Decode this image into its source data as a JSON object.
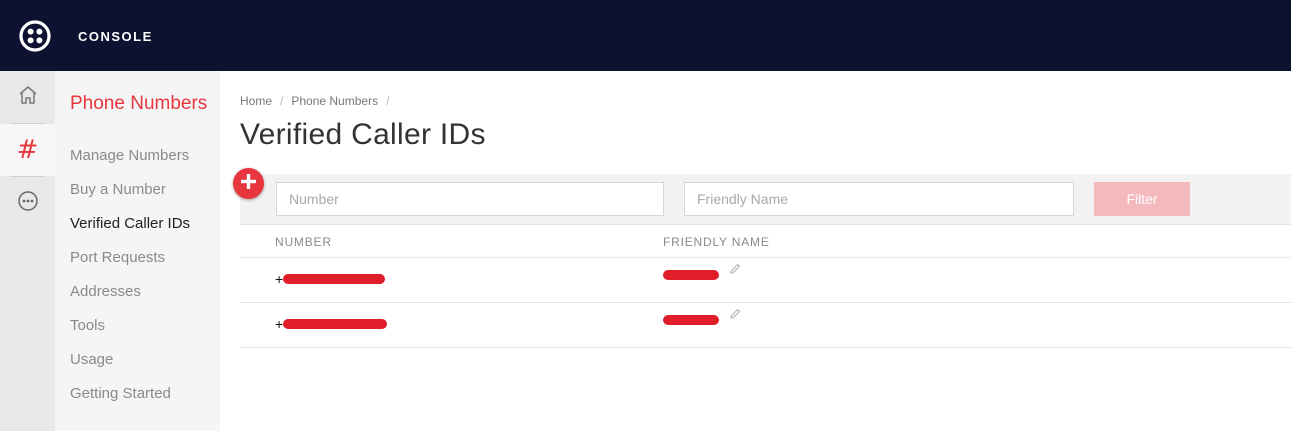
{
  "header": {
    "app_title": "CONSOLE",
    "logo_icon": "twilio-logo-icon",
    "background": "#0d1230"
  },
  "rail": {
    "items": [
      {
        "icon": "home-icon"
      },
      {
        "icon": "hash-icon",
        "label": "#",
        "active": true
      },
      {
        "icon": "more-icon"
      }
    ]
  },
  "sidebar": {
    "title": "Phone Numbers",
    "accent": "#e8363e",
    "items": [
      {
        "label": "Manage Numbers"
      },
      {
        "label": "Buy a Number"
      },
      {
        "label": "Verified Caller IDs",
        "active": true
      },
      {
        "label": "Port Requests"
      },
      {
        "label": "Addresses"
      },
      {
        "label": "Tools"
      },
      {
        "label": "Usage"
      },
      {
        "label": "Getting Started"
      }
    ]
  },
  "breadcrumb": {
    "items": [
      "Home",
      "Phone Numbers"
    ],
    "separator": "/"
  },
  "page": {
    "title": "Verified Caller IDs"
  },
  "filters": {
    "add_icon": "plus-circle-icon",
    "number_placeholder": "Number",
    "friendly_name_placeholder": "Friendly Name",
    "filter_label": "Filter",
    "filter_color": "#f4b9bd"
  },
  "table": {
    "columns": [
      "NUMBER",
      "FRIENDLY NAME"
    ],
    "rows": [
      {
        "number_prefix": "+",
        "friendly_name_redacted": true,
        "edit_icon": "pencil-icon"
      },
      {
        "number_prefix": "+",
        "friendly_name_redacted": true,
        "edit_icon": "pencil-icon"
      }
    ]
  }
}
